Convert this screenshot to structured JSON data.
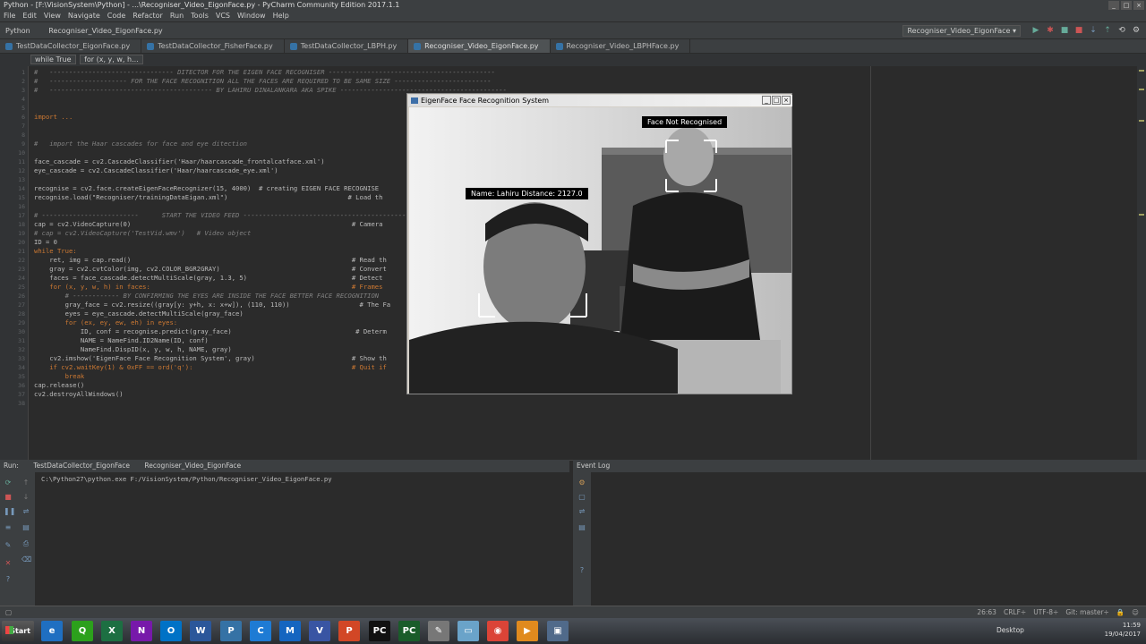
{
  "window": {
    "title": "Python - [F:\\VisionSystem\\Python] - ...\\Recogniser_Video_EigonFace.py - PyCharm Community Edition 2017.1.1"
  },
  "menu": [
    "File",
    "Edit",
    "View",
    "Navigate",
    "Code",
    "Refactor",
    "Run",
    "Tools",
    "VCS",
    "Window",
    "Help"
  ],
  "nav": {
    "project": "Python",
    "file": "Recogniser_Video_EigonFace.py",
    "run_config": "Recogniser_Video_EigonFace"
  },
  "tabs": [
    {
      "label": "TestDataCollector_EigonFace.py",
      "active": false
    },
    {
      "label": "TestDataCollector_FisherFace.py",
      "active": false
    },
    {
      "label": "TestDataCollector_LBPH.py",
      "active": false
    },
    {
      "label": "Recogniser_Video_EigonFace.py",
      "active": true
    },
    {
      "label": "Recogniser_Video_LBPHFace.py",
      "active": false
    }
  ],
  "breadcrumb": [
    "while True",
    "for (x, y, w, h..."
  ],
  "code_lines": [
    "#   -------------------------------- DITECTOR FOR THE EIGEN FACE RECOGNISER -------------------------------------------",
    "#   -------------------- FOR THE FACE RECOGNITION ALL THE FACES ARE REQUIRED TO BE SAME SIZE -------------------------",
    "#   ------------------------------------------ BY LAHIRU DINALANKARA AKA SPIKE -------------------------------------------",
    "",
    "",
    "import ...",
    "",
    "",
    "#   import the Haar cascades for face and eye ditection",
    "",
    "face_cascade = cv2.CascadeClassifier('Haar/haarcascade_frontalcatface.xml')",
    "eye_cascade = cv2.CascadeClassifier('Haar/haarcascade_eye.xml')",
    "",
    "recognise = cv2.face.createEigenFaceRecognizer(15, 4000)  # creating EIGEN FACE RECOGNISE",
    "recognise.load(\"Recogniser/trainingDataEigan.xml\")                               # Load th",
    "",
    "# -------------------------      START THE VIDEO FEED ------------------------------------------",
    "cap = cv2.VideoCapture(0)                                                         # Camera",
    "# cap = cv2.VideoCapture('TestVid.wmv')   # Video object",
    "ID = 0",
    "while True:",
    "    ret, img = cap.read()                                                         # Read th",
    "    gray = cv2.cvtColor(img, cv2.COLOR_BGR2GRAY)                                  # Convert",
    "    faces = face_cascade.detectMultiScale(gray, 1.3, 5)                           # Detect",
    "    for (x, y, w, h) in faces:                                                    # Frames",
    "        # ------------ BY CONFIRMING THE EYES ARE INSIDE THE FACE BETTER FACE RECOGNITION",
    "        gray_face = cv2.resize((gray[y: y+h, x: x+w]), (110, 110))                  # The Fa",
    "        eyes = eye_cascade.detectMultiScale(gray_face)",
    "        for (ex, ey, ew, eh) in eyes:",
    "            ID, conf = recognise.predict(gray_face)                                # Determ",
    "            NAME = NameFind.ID2Name(ID, conf)",
    "            NameFind.DispID(x, y, w, h, NAME, gray)",
    "    cv2.imshow('EigenFace Face Recognition System', gray)                         # Show th",
    "    if cv2.waitKey(1) & 0xFF == ord('q'):                                         # Quit if",
    "        break",
    "cap.release()",
    "cv2.destroyAllWindows()"
  ],
  "line_numbers": [
    "1",
    "2",
    "3",
    "4",
    "5",
    "6",
    "7",
    "8",
    "9",
    "10",
    "11",
    "12",
    "13",
    "14",
    "15",
    "16",
    "17",
    "18",
    "19",
    "20",
    "21",
    "22",
    "23",
    "24",
    "25",
    "26",
    "27",
    "28",
    "29",
    "30",
    "31",
    "32",
    "33",
    "34",
    "35",
    "36",
    "37",
    "38"
  ],
  "popup": {
    "title": "EigenFace Face Recognition System",
    "label_unknown": "Face Not Recognised",
    "label_known": "Name: Lahiru Distance: 2127.0"
  },
  "run_panel": {
    "label": "Run:",
    "tabs": [
      "TestDataCollector_EigonFace",
      "Recogniser_Video_EigonFace"
    ],
    "output": "C:\\Python27\\python.exe F:/VisionSystem/Python/Recogniser_Video_EigonFace.py"
  },
  "event_log": {
    "title": "Event Log"
  },
  "status": {
    "pos": "26:63",
    "eol": "CRLF÷",
    "enc": "UTF-8÷",
    "git": "Git: master÷"
  },
  "taskbar": {
    "start": "Start",
    "desktop": "Desktop",
    "time": "11:59",
    "date": "19/04/2017"
  }
}
